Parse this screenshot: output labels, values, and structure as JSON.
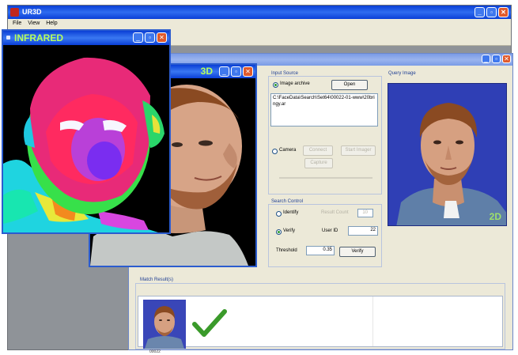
{
  "app": {
    "title": "UR3D",
    "menu": [
      "File",
      "View",
      "Help"
    ]
  },
  "input_source": {
    "label": "Input Source",
    "image_archive_label": "Image archive",
    "open_label": "Open",
    "path": "C:\\FaceData\\Search\\Set64\\00022-01-www\\20bringy.ar",
    "camera_label": "Camera",
    "connect_label": "Connect",
    "start_label": "Start Imager",
    "capture_label": "Capture"
  },
  "search_control": {
    "label": "Search Control",
    "identify_label": "Identify",
    "result_count_label": "Result Count",
    "result_count_value": "10",
    "verify_radio_label": "Verify",
    "user_id_label": "User ID",
    "user_id_value": "22",
    "threshold_label": "Threshold",
    "threshold_value": "0.35",
    "verify_button_label": "Verify"
  },
  "query_image": {
    "label": "Query Image",
    "badge": "2D"
  },
  "match_results": {
    "label": "Match Result(s)",
    "id": "00022"
  },
  "win3d": {
    "label": "3D"
  },
  "infrared": {
    "label": "INFRARED"
  },
  "colors": {
    "titlebar": "#0a3fd6",
    "window_label": "#b6ff5e",
    "check": "#3a9a2a",
    "query_bg": "#2f3fb5"
  }
}
